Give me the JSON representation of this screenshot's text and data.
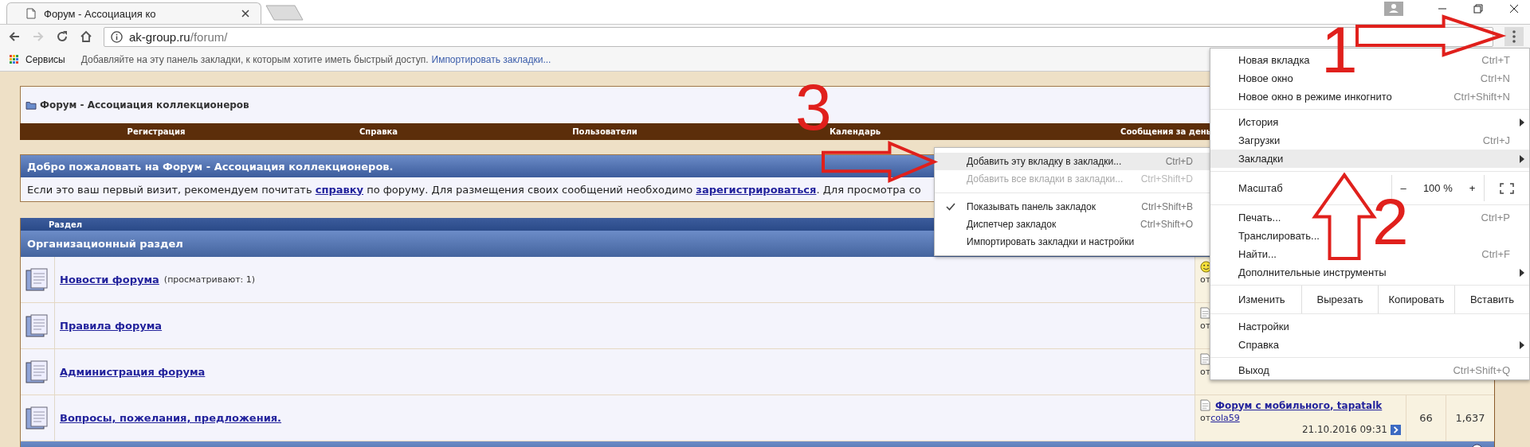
{
  "browser": {
    "tabs": [
      {
        "title": "Форум - Ассоциация ко",
        "selected": true
      }
    ],
    "address": {
      "host": "ak-group.ru",
      "path": "/forum/"
    },
    "bookmarks_bar": {
      "apps": "Сервисы",
      "hint": "Добавляйте на эту панель закладки, к которым хотите иметь быстрый доступ.",
      "import_link": "Импортировать закладки..."
    }
  },
  "forum": {
    "title": "Форум - Ассоциация коллекционеров",
    "nav": [
      "Регистрация",
      "Справка",
      "Пользователи",
      "Календарь",
      "Сообщения за день"
    ],
    "welcome": {
      "title": "Добро пожаловать на Форум - Ассоциация коллекционеров.",
      "text": [
        {
          "text": "Если это ваш первый визит, рекомендуем почитать ",
          "link": false
        },
        {
          "text": "справку",
          "link": true
        },
        {
          "text": " по форуму. Для размещения своих сообщений необходимо ",
          "link": false
        },
        {
          "text": "зарегистрироваться",
          "link": true
        },
        {
          "text": ". Для просмотра со",
          "link": false
        }
      ]
    },
    "table": {
      "column_header": "Раздел",
      "category": "Организационный раздел",
      "forums": [
        {
          "name": "Новости форума",
          "viewers": "(просматривают: 1)",
          "last_post": {
            "kind": "smiley",
            "by": "от"
          }
        },
        {
          "name": "Правила форума",
          "last_post": {
            "kind": "document",
            "by": "от"
          }
        },
        {
          "name": "Администрация форума",
          "last_post": {
            "kind": "document",
            "by": "от"
          }
        },
        {
          "name": "Вопросы, пожелания, предложения.",
          "last_post": {
            "kind": "document",
            "title": "Форум с мобильного, tapatalk",
            "by": "от",
            "author": "cola59",
            "date": "21.10.2016 09:31"
          },
          "topics": "66",
          "posts": "1,637"
        }
      ]
    }
  },
  "bookmarks_submenu": [
    {
      "kind": "item",
      "label": "Добавить эту вкладку в закладки...",
      "shortcut": "Ctrl+D",
      "selected": true,
      "disabled": false,
      "checked": false
    },
    {
      "kind": "item",
      "label": "Добавить все вкладки в закладки...",
      "shortcut": "Ctrl+Shift+D",
      "selected": false,
      "disabled": true,
      "checked": false
    },
    {
      "kind": "separator"
    },
    {
      "kind": "item",
      "label": "Показывать панель закладок",
      "shortcut": "Ctrl+Shift+B",
      "selected": false,
      "disabled": false,
      "checked": true
    },
    {
      "kind": "item",
      "label": "Диспетчер закладок",
      "shortcut": "Ctrl+Shift+O",
      "selected": false,
      "disabled": false,
      "checked": false
    },
    {
      "kind": "item",
      "label": "Импортировать закладки и настройки",
      "selected": false,
      "disabled": false,
      "checked": false
    }
  ],
  "chrome_menu": [
    {
      "kind": "item",
      "label": "Новая вкладка",
      "shortcut": "Ctrl+T",
      "submenu": false,
      "selected": false
    },
    {
      "kind": "item",
      "label": "Новое окно",
      "shortcut": "Ctrl+N",
      "submenu": false,
      "selected": false
    },
    {
      "kind": "item",
      "label": "Новое окно в режиме инкогнито",
      "shortcut": "Ctrl+Shift+N",
      "submenu": false,
      "selected": false
    },
    {
      "kind": "separator"
    },
    {
      "kind": "item",
      "label": "История",
      "submenu": true,
      "selected": false
    },
    {
      "kind": "item",
      "label": "Загрузки",
      "shortcut": "Ctrl+J",
      "submenu": false,
      "selected": false
    },
    {
      "kind": "item",
      "label": "Закладки",
      "submenu": true,
      "selected": true
    },
    {
      "kind": "separator"
    },
    {
      "kind": "zoom",
      "label": "Масштаб",
      "minus": "–",
      "value": "100 %",
      "plus": "+"
    },
    {
      "kind": "separator"
    },
    {
      "kind": "item",
      "label": "Печать...",
      "shortcut": "Ctrl+P",
      "submenu": false,
      "selected": false
    },
    {
      "kind": "item",
      "label": "Транслировать...",
      "submenu": false,
      "selected": false
    },
    {
      "kind": "item",
      "label": "Найти...",
      "shortcut": "Ctrl+F",
      "submenu": false,
      "selected": false
    },
    {
      "kind": "item",
      "label": "Дополнительные инструменты",
      "submenu": true,
      "selected": false
    },
    {
      "kind": "separator"
    },
    {
      "kind": "edit",
      "label": "Изменить",
      "buttons": [
        "Вырезать",
        "Копировать",
        "Вставить"
      ]
    },
    {
      "kind": "separator"
    },
    {
      "kind": "item",
      "label": "Настройки",
      "submenu": false,
      "selected": false
    },
    {
      "kind": "item",
      "label": "Справка",
      "submenu": true,
      "selected": false
    },
    {
      "kind": "separator"
    },
    {
      "kind": "item",
      "label": "Выход",
      "shortcut": "Ctrl+Shift+Q",
      "submenu": false,
      "selected": false
    }
  ],
  "annotations": [
    {
      "kind": "right-arrow",
      "number": "1"
    },
    {
      "kind": "up-arrow",
      "number": "2"
    },
    {
      "kind": "right-arrow",
      "number": "3"
    }
  ]
}
